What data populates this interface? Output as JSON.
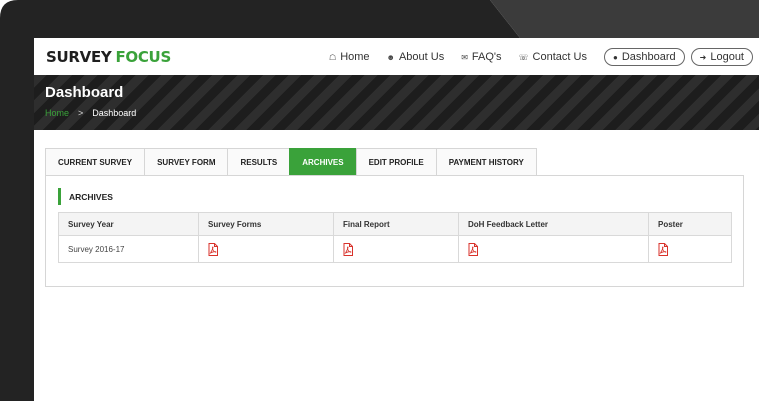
{
  "logo": {
    "part1": "SURVEY",
    "part2": "FOCUS"
  },
  "nav": {
    "home": "Home",
    "about": "About Us",
    "faqs": "FAQ's",
    "contact": "Contact Us",
    "dashboard": "Dashboard",
    "logout": "Logout"
  },
  "banner": {
    "title": "Dashboard",
    "breadcrumb": {
      "home": "Home",
      "separator": ">",
      "current": "Dashboard"
    }
  },
  "tabs": [
    {
      "label": "CURRENT SURVEY"
    },
    {
      "label": "SURVEY FORM"
    },
    {
      "label": "RESULTS"
    },
    {
      "label": "ARCHIVES",
      "active": true
    },
    {
      "label": "EDIT PROFILE"
    },
    {
      "label": "PAYMENT HISTORY"
    }
  ],
  "archives": {
    "title": "ARCHIVES",
    "columns": [
      "Survey Year",
      "Survey Forms",
      "Final Report",
      "DoH Feedback Letter",
      "Poster"
    ],
    "rows": [
      {
        "year": "Survey 2016-17",
        "files": [
          "pdf-icon",
          "pdf-icon",
          "pdf-icon",
          "pdf-icon"
        ]
      }
    ]
  },
  "colors": {
    "accent": "#3aa23a",
    "banner": "#262626",
    "pdf": "#d9322b"
  }
}
